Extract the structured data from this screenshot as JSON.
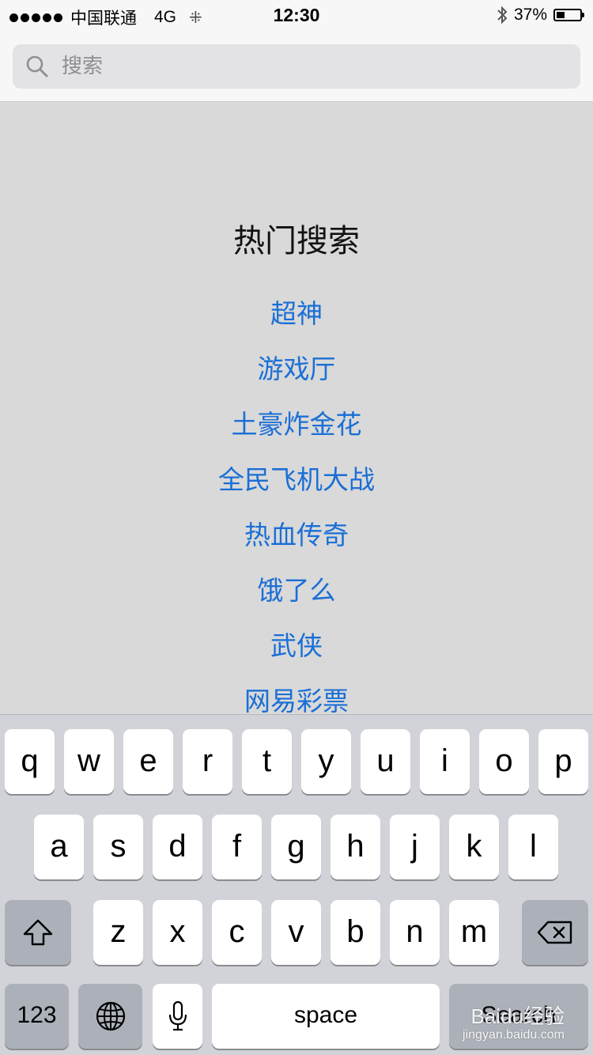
{
  "status_bar": {
    "carrier": "中国联通",
    "network": "4G",
    "time": "12:30",
    "battery_percent": "37%",
    "battery_level": 0.37
  },
  "search": {
    "placeholder": "搜索"
  },
  "hot_search": {
    "title": "热门搜索",
    "items": [
      "超神",
      "游戏厅",
      "土豪炸金花",
      "全民飞机大战",
      "热血传奇",
      "饿了么",
      "武侠",
      "网易彩票"
    ]
  },
  "keyboard": {
    "row1": [
      "q",
      "w",
      "e",
      "r",
      "t",
      "y",
      "u",
      "i",
      "o",
      "p"
    ],
    "row2": [
      "a",
      "s",
      "d",
      "f",
      "g",
      "h",
      "j",
      "k",
      "l"
    ],
    "row3": [
      "z",
      "x",
      "c",
      "v",
      "b",
      "n",
      "m"
    ],
    "numbers_label": "123",
    "space_label": "space",
    "search_label": "Search"
  },
  "watermark": {
    "brand": "Baidu经验",
    "url": "jingyan.baidu.com"
  }
}
